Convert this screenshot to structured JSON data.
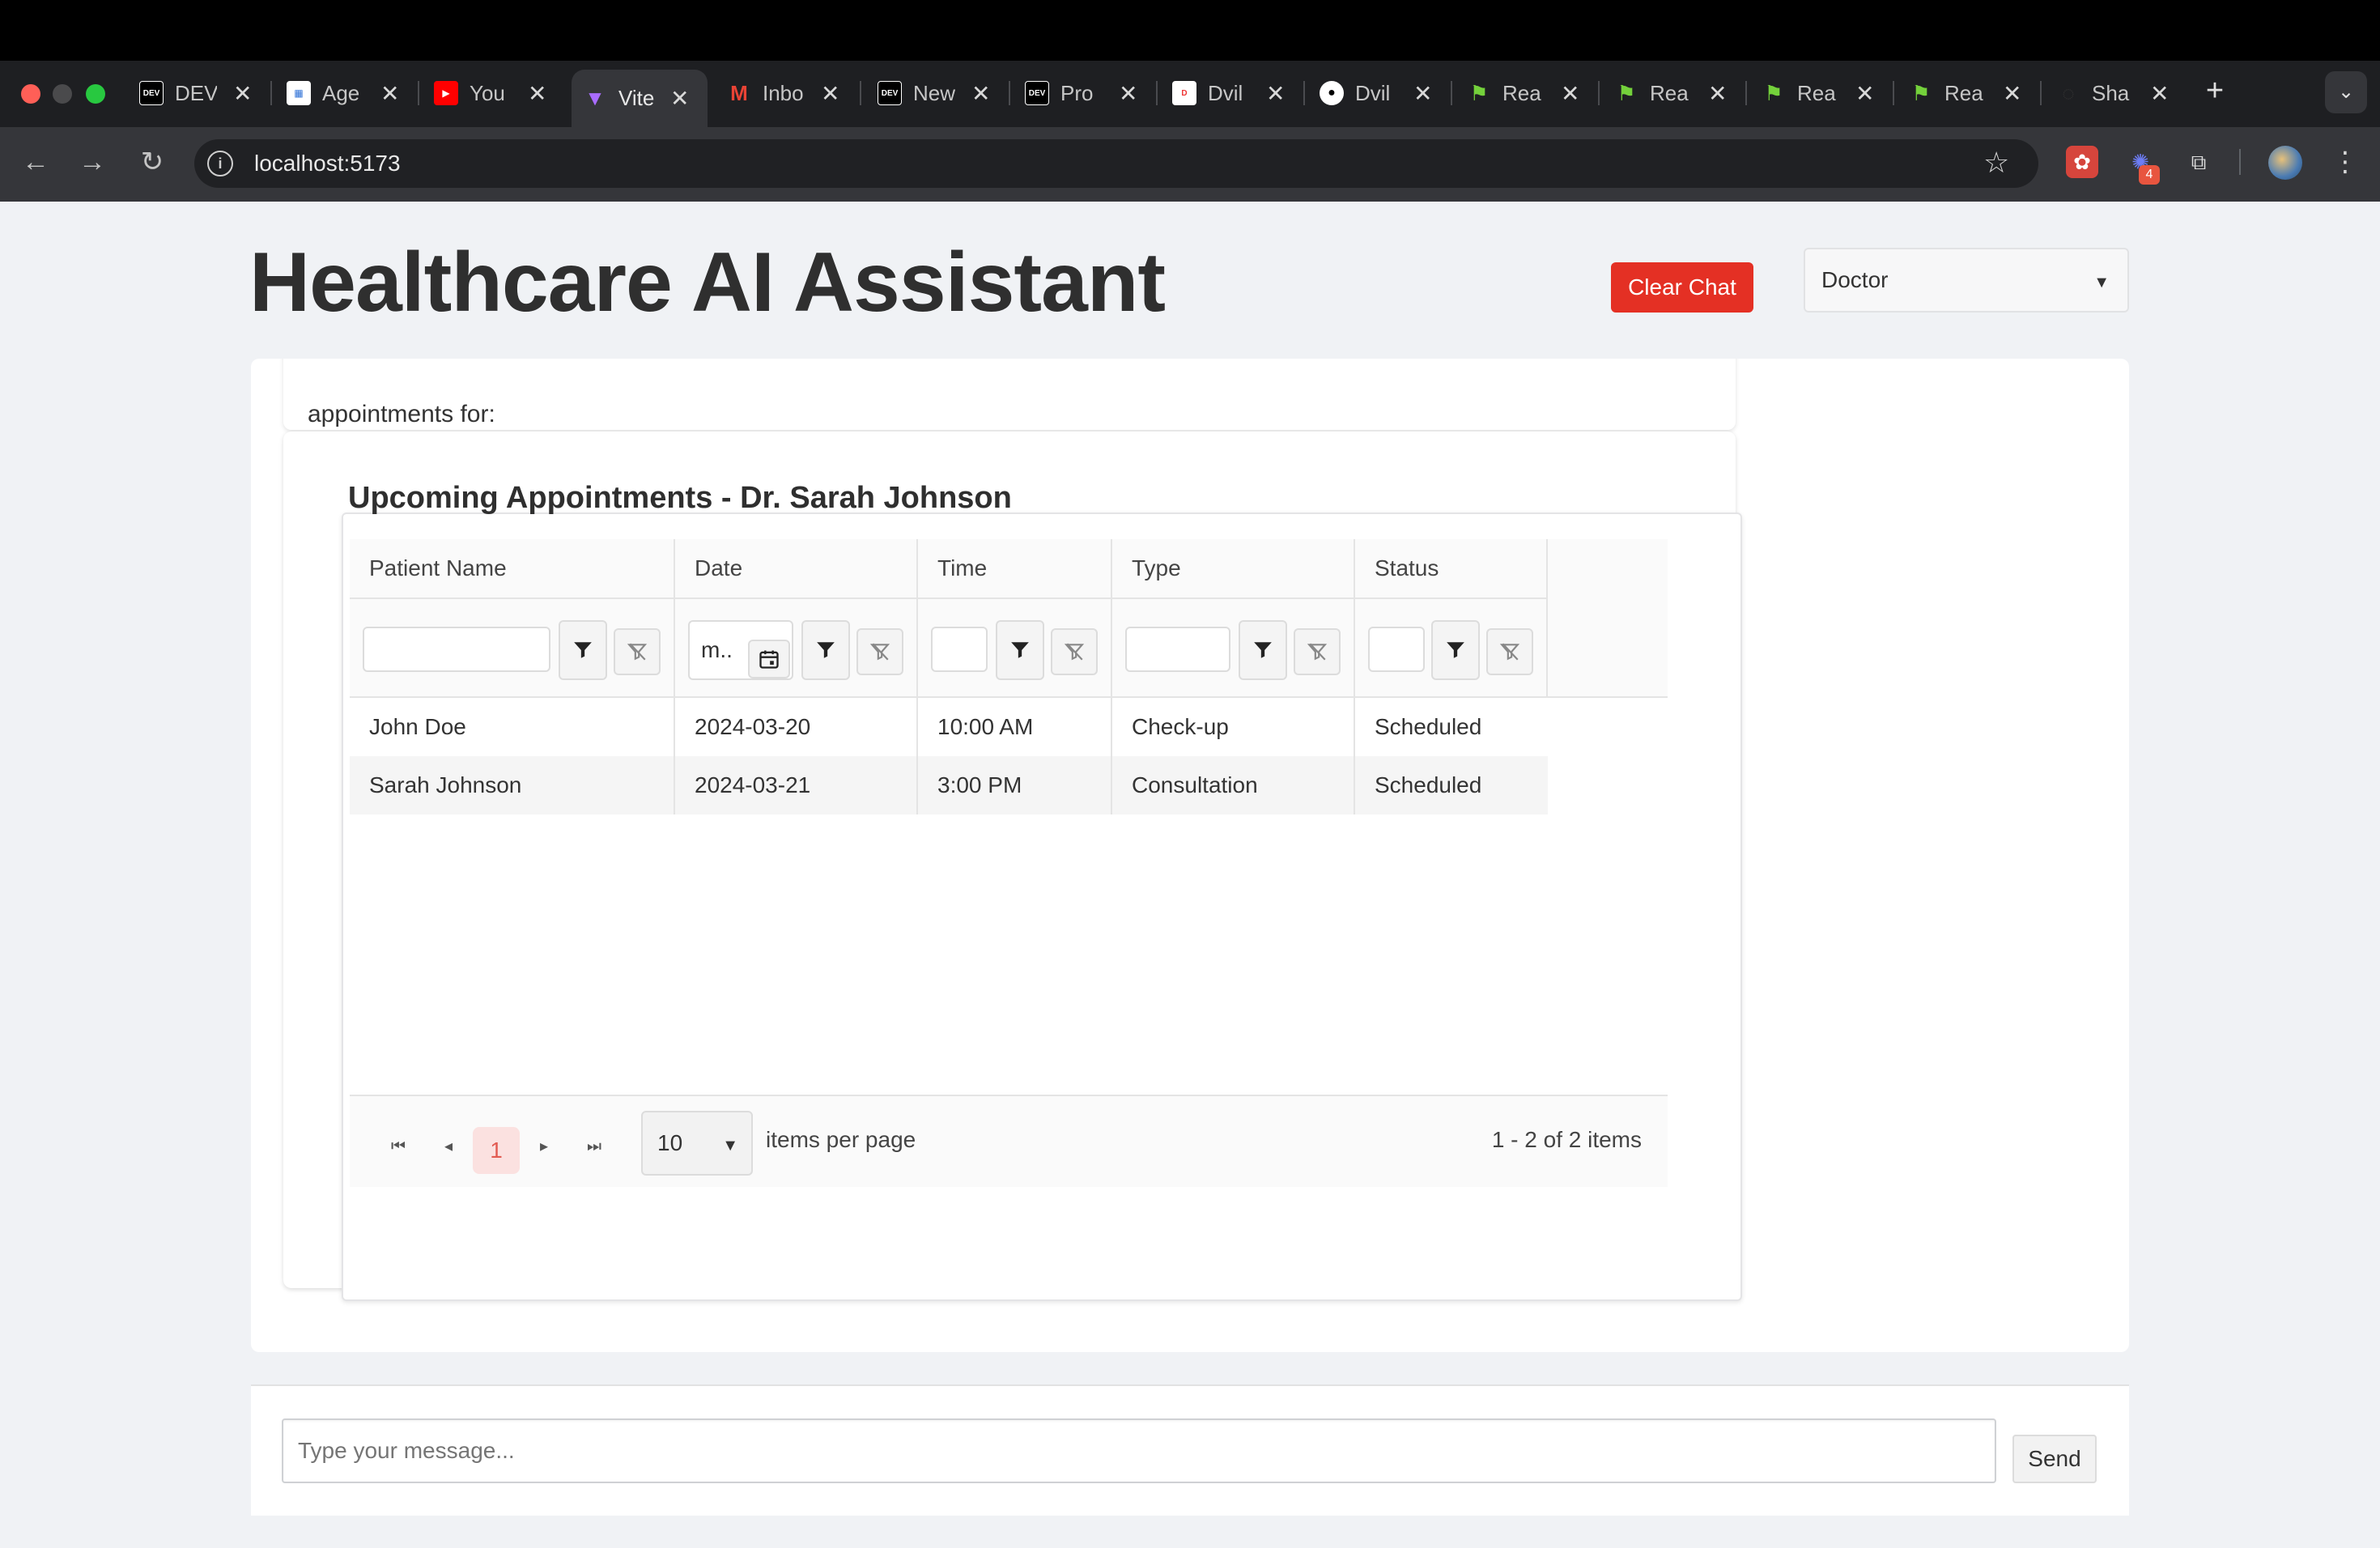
{
  "browser": {
    "tabs": [
      {
        "title": "DEV",
        "icon": "dev-icon"
      },
      {
        "title": "Age",
        "icon": "agenda-icon"
      },
      {
        "title": "You",
        "icon": "youtube-icon"
      },
      {
        "title": "Vite",
        "icon": "vite-icon",
        "active": true
      },
      {
        "title": "Inbo",
        "icon": "gmail-icon"
      },
      {
        "title": "New",
        "icon": "dev-icon"
      },
      {
        "title": "Pro",
        "icon": "dev-icon"
      },
      {
        "title": "Dvil",
        "icon": "document-icon"
      },
      {
        "title": "Dvil",
        "icon": "github-icon"
      },
      {
        "title": "Rea",
        "icon": "rea-icon"
      },
      {
        "title": "Rea",
        "icon": "rea-icon"
      },
      {
        "title": "Rea",
        "icon": "rea-icon"
      },
      {
        "title": "Rea",
        "icon": "rea-icon"
      },
      {
        "title": "Sha",
        "icon": "share-icon"
      }
    ],
    "url": "localhost:5173",
    "extension_badge": "4"
  },
  "app": {
    "title": "Healthcare AI Assistant",
    "clear_chat_label": "Clear Chat",
    "role_select_value": "Doctor"
  },
  "chat": {
    "previous_message_tail": "appointments for:",
    "grid": {
      "title": "Upcoming Appointments - Dr. Sarah Johnson",
      "columns": [
        "Patient Name",
        "Date",
        "Time",
        "Type",
        "Status"
      ],
      "date_filter_value": "m..",
      "rows": [
        [
          "John Doe",
          "2024-03-20",
          "10:00 AM",
          "Check-up",
          "Scheduled"
        ],
        [
          "Sarah Johnson",
          "2024-03-21",
          "3:00 PM",
          "Consultation",
          "Scheduled"
        ]
      ],
      "pager": {
        "current_page": "1",
        "page_size": "10",
        "items_per_page_label": "items per page",
        "info": "1 - 2 of 2 items"
      }
    },
    "input_placeholder": "Type your message...",
    "send_label": "Send"
  },
  "colors": {
    "accent_red": "#e43024",
    "page_bg": "#f0f2f5"
  }
}
